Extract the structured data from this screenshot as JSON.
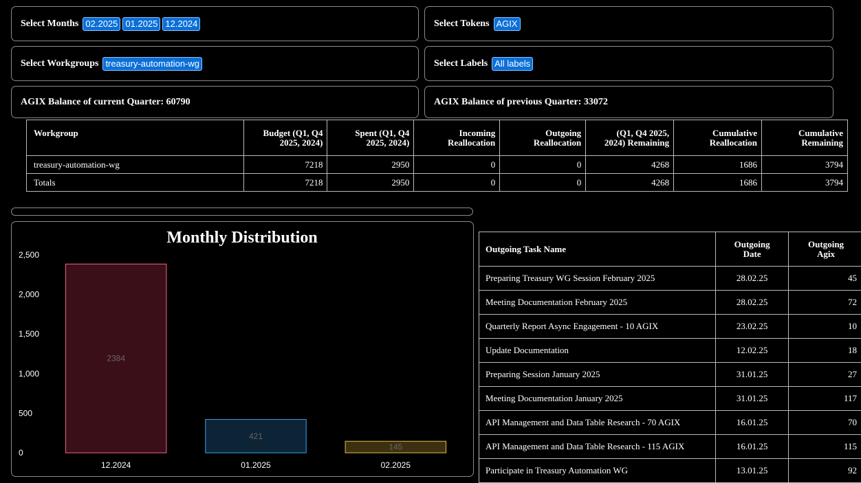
{
  "filters": {
    "months": {
      "label": "Select Months",
      "chips": [
        "02.2025",
        "01.2025",
        "12.2024"
      ]
    },
    "tokens": {
      "label": "Select Tokens",
      "chips": [
        "AGIX"
      ]
    },
    "workgroups": {
      "label": "Select Workgroups",
      "chips": [
        "treasury-automation-wg"
      ]
    },
    "labels": {
      "label": "Select Labels",
      "chips": [
        "All labels"
      ]
    }
  },
  "balances": {
    "current": "AGIX Balance of current Quarter: 60790",
    "previous": "AGIX Balance of previous Quarter: 33072"
  },
  "budget_table": {
    "headers": [
      [
        "Workgroup"
      ],
      [
        "Budget (Q1, Q4",
        "2025, 2024)"
      ],
      [
        "Spent (Q1, Q4",
        "2025, 2024)"
      ],
      [
        "Incoming",
        "Reallocation"
      ],
      [
        "Outgoing",
        "Reallocation"
      ],
      [
        "(Q1, Q4 2025,",
        "2024) Remaining"
      ],
      [
        "Cumulative",
        "Reallocation"
      ],
      [
        "Cumulative",
        "Remaining"
      ]
    ],
    "rows": [
      [
        "treasury-automation-wg",
        "7218",
        "2950",
        "0",
        "0",
        "4268",
        "1686",
        "3794"
      ],
      [
        "Totals",
        "7218",
        "2950",
        "0",
        "0",
        "4268",
        "1686",
        "3794"
      ]
    ]
  },
  "chart_data": {
    "type": "bar",
    "title": "Monthly Distribution",
    "categories": [
      "12.2024",
      "01.2025",
      "02.2025"
    ],
    "values": [
      2384,
      421,
      145
    ],
    "data_labels": [
      "2384",
      "421",
      "145"
    ],
    "ylim": [
      0,
      2500
    ],
    "yticks": [
      0,
      500,
      1000,
      1500,
      2000,
      2500
    ],
    "ytick_labels": [
      "0",
      "500",
      "1,000",
      "1,500",
      "2,000",
      "2,500"
    ],
    "grid": false,
    "colors": {
      "fills": [
        "#3a0f18",
        "#0d2336",
        "#3d3010"
      ],
      "strokes": [
        "#d4567a",
        "#2e8fd0",
        "#c9a640"
      ]
    }
  },
  "tasks_table": {
    "headers": [
      [
        "Outgoing Task Name"
      ],
      [
        "Outgoing",
        "Date"
      ],
      [
        "Outgoing",
        "Agix"
      ]
    ],
    "rows": [
      [
        "Preparing Treasury WG Session February 2025",
        "28.02.25",
        "45"
      ],
      [
        "Meeting Documentation February 2025",
        "28.02.25",
        "72"
      ],
      [
        "Quarterly Report Async Engagement - 10 AGIX",
        "23.02.25",
        "10"
      ],
      [
        "Update Documentation",
        "12.02.25",
        "18"
      ],
      [
        "Preparing Session January 2025",
        "31.01.25",
        "27"
      ],
      [
        "Meeting Documentation January 2025",
        "31.01.25",
        "117"
      ],
      [
        "API Management and Data Table Research - 70 AGIX",
        "16.01.25",
        "70"
      ],
      [
        "API Management and Data Table Research - 115 AGIX",
        "16.01.25",
        "115"
      ],
      [
        "Participate in Treasury Automation WG",
        "13.01.25",
        "92"
      ]
    ]
  },
  "colors": {
    "chip_bg": "#0b6fd8",
    "panel_border": "#8a8a8a",
    "background": "#000000"
  }
}
